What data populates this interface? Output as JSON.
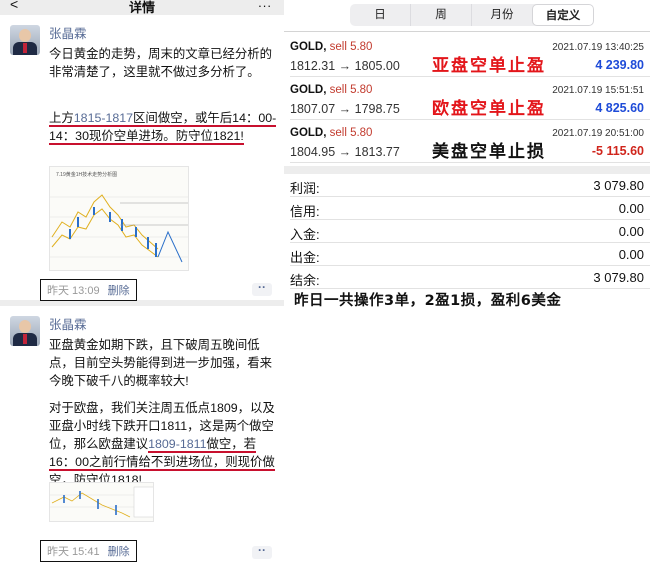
{
  "wechat": {
    "header": {
      "back": "<",
      "title": "详情",
      "more": "..."
    },
    "posts": [
      {
        "username": "张晶霖",
        "text_a": "今日黄金的走势，周末的文章已经分析的非常清楚了，这里就不做过多分析了。",
        "text_b1": "上方",
        "text_b_link": "1815-1817",
        "text_b2": "区间做空，或午后14：00-14：30现价空单进场。防守位1821!",
        "thumb_caption": "7.19黄金1H技术走势分析图",
        "time": "昨天 13:09",
        "delete": "删除"
      },
      {
        "username": "张晶霖",
        "text_a": "亚盘黄金如期下跌，且下破周五晚间低点，目前空头势能得到进一步加强，看来今晚下破千八的概率较大!",
        "text_b1": "对于欧盘，我们关注周五低点1809，以及亚盘小时线下跌开口1811，这是两个做空位，那么欧盘建议",
        "text_b_link": "1809-1811",
        "text_b2": "做空，若16：00之前行情给不到进场位，则现价做空，防守位1818!",
        "time": "昨天 15:41",
        "delete": "删除"
      }
    ]
  },
  "mt4": {
    "tabs": [
      "日",
      "周",
      "月份",
      "自定义"
    ],
    "active_tab": "自定义",
    "trades": [
      {
        "symbol": "GOLD,",
        "side": "sell 5.80",
        "datetime": "2021.07.19 13:40:25",
        "prices": "1812.31 → 1805.00",
        "profit": "4 239.80",
        "profit_color": "#1e4bd8",
        "note": "亚盘空单止盈",
        "note_color": "#e3151a"
      },
      {
        "symbol": "GOLD,",
        "side": "sell 5.80",
        "datetime": "2021.07.19 15:51:51",
        "prices": "1807.07 → 1798.75",
        "profit": "4 825.60",
        "profit_color": "#1e4bd8",
        "note": "欧盘空单止盈",
        "note_color": "#e3151a"
      },
      {
        "symbol": "GOLD,",
        "side": "sell 5.80",
        "datetime": "2021.07.19 20:51:00",
        "prices": "1804.95 → 1813.77",
        "profit": "-5 115.60",
        "profit_color": "#d0251c",
        "note": "美盘空单止损",
        "note_color": "#111111"
      }
    ],
    "summary": [
      {
        "label": "利润:",
        "value": "3 079.80"
      },
      {
        "label": "信用:",
        "value": "0.00"
      },
      {
        "label": "入金:",
        "value": "0.00"
      },
      {
        "label": "出金:",
        "value": "0.00"
      },
      {
        "label": "结余:",
        "value": "3 079.80"
      }
    ],
    "caption": "昨日一共操作3单，2盈1损，盈利6美金"
  }
}
